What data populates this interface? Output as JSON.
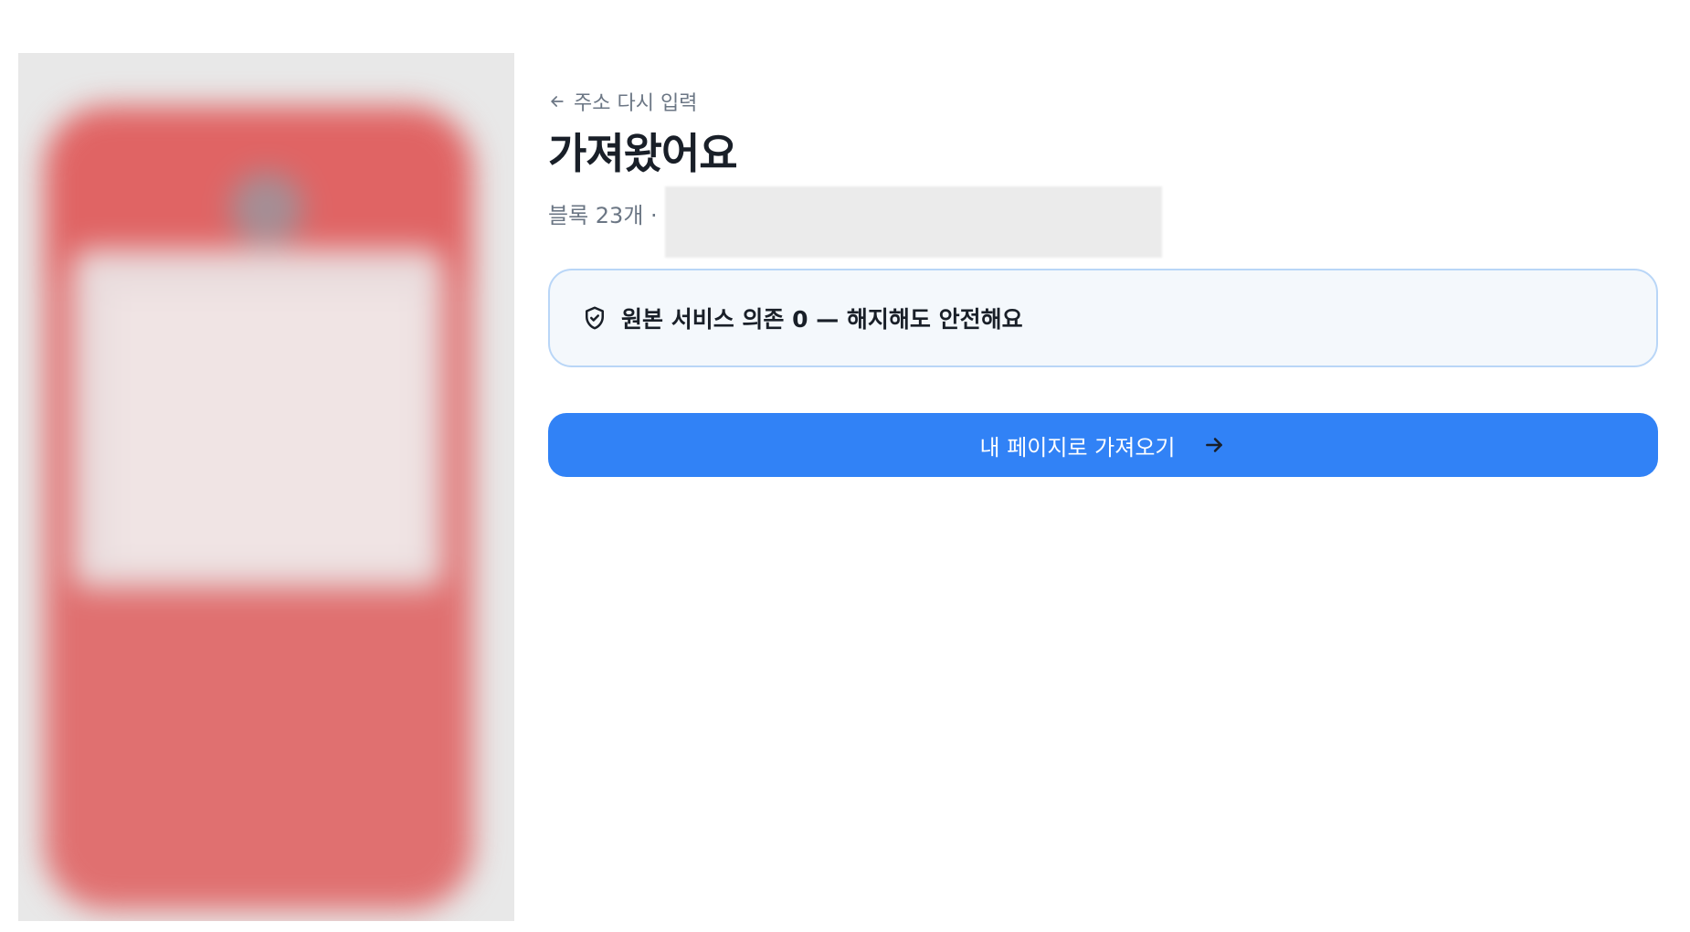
{
  "header": {
    "back_label": "주소 다시 입력",
    "title": "가져왔어요",
    "meta": "블록 23개 ·"
  },
  "notice": {
    "text": "원본 서비스 의존 0 — 해지해도 안전해요",
    "icon": "shield-check-icon"
  },
  "cta": {
    "label": "내 페이지로 가져오기",
    "icon": "arrow-right-icon"
  },
  "colors": {
    "primary": "#3182f6",
    "notice_bg": "#f4f8fc",
    "notice_border": "#b9d6f7",
    "preview_accent": "#e07070"
  }
}
